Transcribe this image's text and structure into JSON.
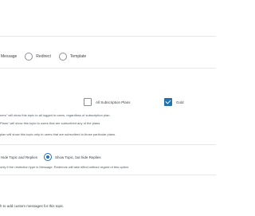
{
  "restriction_type": {
    "options": [
      {
        "label": "Message",
        "checked": false
      },
      {
        "label": "Redirect",
        "checked": false
      },
      {
        "label": "Template",
        "checked": false
      }
    ]
  },
  "plans": {
    "all_plans": {
      "label": "All Subscription Plans",
      "checked": false
    },
    "gold": {
      "label": "Gold",
      "checked": true
    },
    "descriptions": [
      "ners\" will show this topic to all logged in users, regardless of subscription plan.",
      "Plans\" will show this topic to users that are subscribed any of the plans.",
      "plan will show this topic only to users that are subscribed to those particular plans."
    ]
  },
  "display": {
    "options": [
      {
        "label": "Hide Topic and Replies",
        "checked": false
      },
      {
        "label": "Show Topic, but hide Replies",
        "checked": true
      }
    ],
    "note": "only if the restriction type is Message. Redirects will take effect without regard of this option."
  },
  "custom_messages": {
    "text": "h to add custom messages for this topic."
  }
}
